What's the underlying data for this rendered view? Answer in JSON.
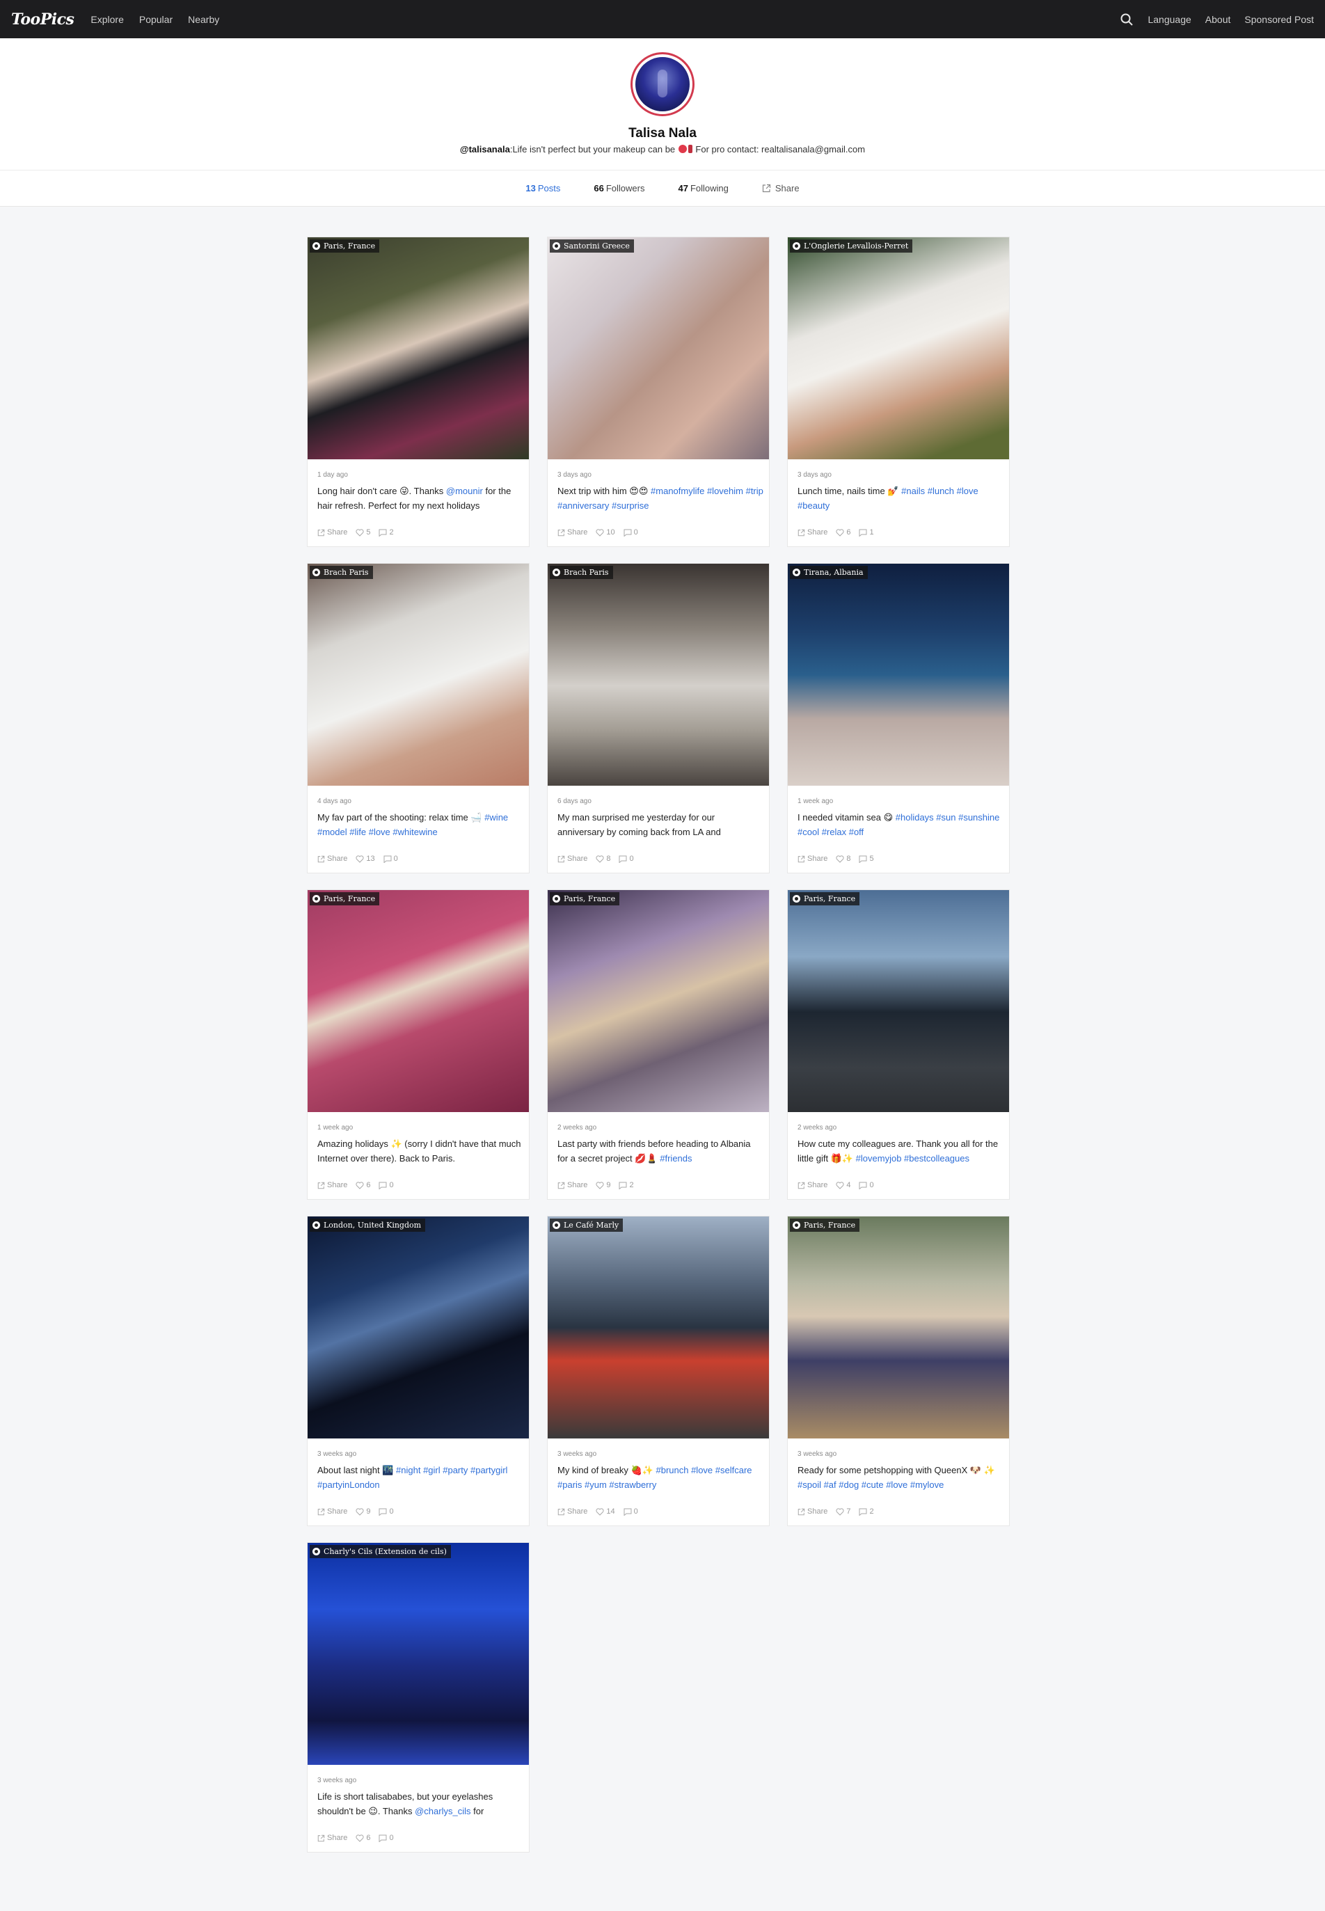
{
  "nav": {
    "logo": "TooPics",
    "links": [
      "Explore",
      "Popular",
      "Nearby"
    ],
    "right_links": [
      "Language",
      "About",
      "Sponsored Post"
    ]
  },
  "profile": {
    "name": "Talisa Nala",
    "handle": "@talisanala",
    "bio_before": ":Life isn't perfect but your makeup can be ",
    "bio_after": " For pro contact: realtalisanala@gmail.com"
  },
  "stats": {
    "posts_count": "13",
    "posts_label": "Posts",
    "followers_count": "66",
    "followers_label": "Followers",
    "following_count": "47",
    "following_label": "Following",
    "share_label": "Share"
  },
  "posts": [
    {
      "location": "Paris, France",
      "time": "1 day ago",
      "text": "Long hair don't care 😜. Thanks ",
      "tags": "@mounir",
      "text2": " for the hair refresh. Perfect for my next holidays",
      "share": "Share",
      "likes": "5",
      "comments": "2"
    },
    {
      "location": "Santorini Greece",
      "time": "3 days ago",
      "text": "Next trip with him 😍😍 ",
      "tags": "#manofmylife #lovehim #trip #anniversary #surprise",
      "text2": "",
      "share": "Share",
      "likes": "10",
      "comments": "0"
    },
    {
      "location": "L'Onglerie Levallois-Perret",
      "time": "3 days ago",
      "text": "Lunch time, nails time 💅 ",
      "tags": "#nails #lunch #love #beauty",
      "text2": "",
      "share": "Share",
      "likes": "6",
      "comments": "1"
    },
    {
      "location": "Brach Paris",
      "time": "4 days ago",
      "text": "My fav part of the shooting: relax time 🛁 ",
      "tags": "#wine #model #life #love #whitewine",
      "text2": "",
      "share": "Share",
      "likes": "13",
      "comments": "0"
    },
    {
      "location": "Brach Paris",
      "time": "6 days ago",
      "text": "My man surprised me yesterday for our anniversary by coming back from LA and",
      "tags": "",
      "text2": "",
      "share": "Share",
      "likes": "8",
      "comments": "0"
    },
    {
      "location": "Tirana, Albania",
      "time": "1 week ago",
      "text": "I needed vitamin sea 😋 ",
      "tags": "#holidays #sun #sunshine #cool #relax #off",
      "text2": "",
      "share": "Share",
      "likes": "8",
      "comments": "5"
    },
    {
      "location": "Paris, France",
      "time": "1 week ago",
      "text": "Amazing holidays ✨ (sorry I didn't have that much Internet over there). Back to Paris.",
      "tags": "",
      "text2": "",
      "share": "Share",
      "likes": "6",
      "comments": "0"
    },
    {
      "location": "Paris, France",
      "time": "2 weeks ago",
      "text": "Last party with friends before heading to Albania for a secret project 💋💄 ",
      "tags": "#friends",
      "text2": "",
      "share": "Share",
      "likes": "9",
      "comments": "2"
    },
    {
      "location": "Paris, France",
      "time": "2 weeks ago",
      "text": "How cute my colleagues are. Thank you all for the little gift 🎁✨ ",
      "tags": "#lovemyjob #bestcolleagues",
      "text2": "",
      "share": "Share",
      "likes": "4",
      "comments": "0"
    },
    {
      "location": "London, United Kingdom",
      "time": "3 weeks ago",
      "text": "About last night 🌃 ",
      "tags": "#night #girl #party #partygirl #partyinLondon",
      "text2": "",
      "share": "Share",
      "likes": "9",
      "comments": "0"
    },
    {
      "location": "Le Café Marly",
      "time": "3 weeks ago",
      "text": "My kind of breaky 🍓✨ ",
      "tags": "#brunch #love #selfcare #paris #yum #strawberry",
      "text2": "",
      "share": "Share",
      "likes": "14",
      "comments": "0"
    },
    {
      "location": "Paris, France",
      "time": "3 weeks ago",
      "text": "Ready for some petshopping with QueenX 🐶 ✨ ",
      "tags": "#spoil #af #dog #cute #love #mylove",
      "text2": "",
      "share": "Share",
      "likes": "7",
      "comments": "2"
    },
    {
      "location": "Charly's Cils (Extension de cils)",
      "time": "3 weeks ago",
      "text": "Life is short talisababes, but your eyelashes shouldn't be 😉. Thanks ",
      "tags": "@charlys_cils",
      "text2": " for",
      "share": "Share",
      "likes": "6",
      "comments": "0"
    }
  ],
  "colors": {
    "nav_bg": "#1d1d1f",
    "accent": "#2f6fd8",
    "avatar_ring": "#d23a4e"
  }
}
